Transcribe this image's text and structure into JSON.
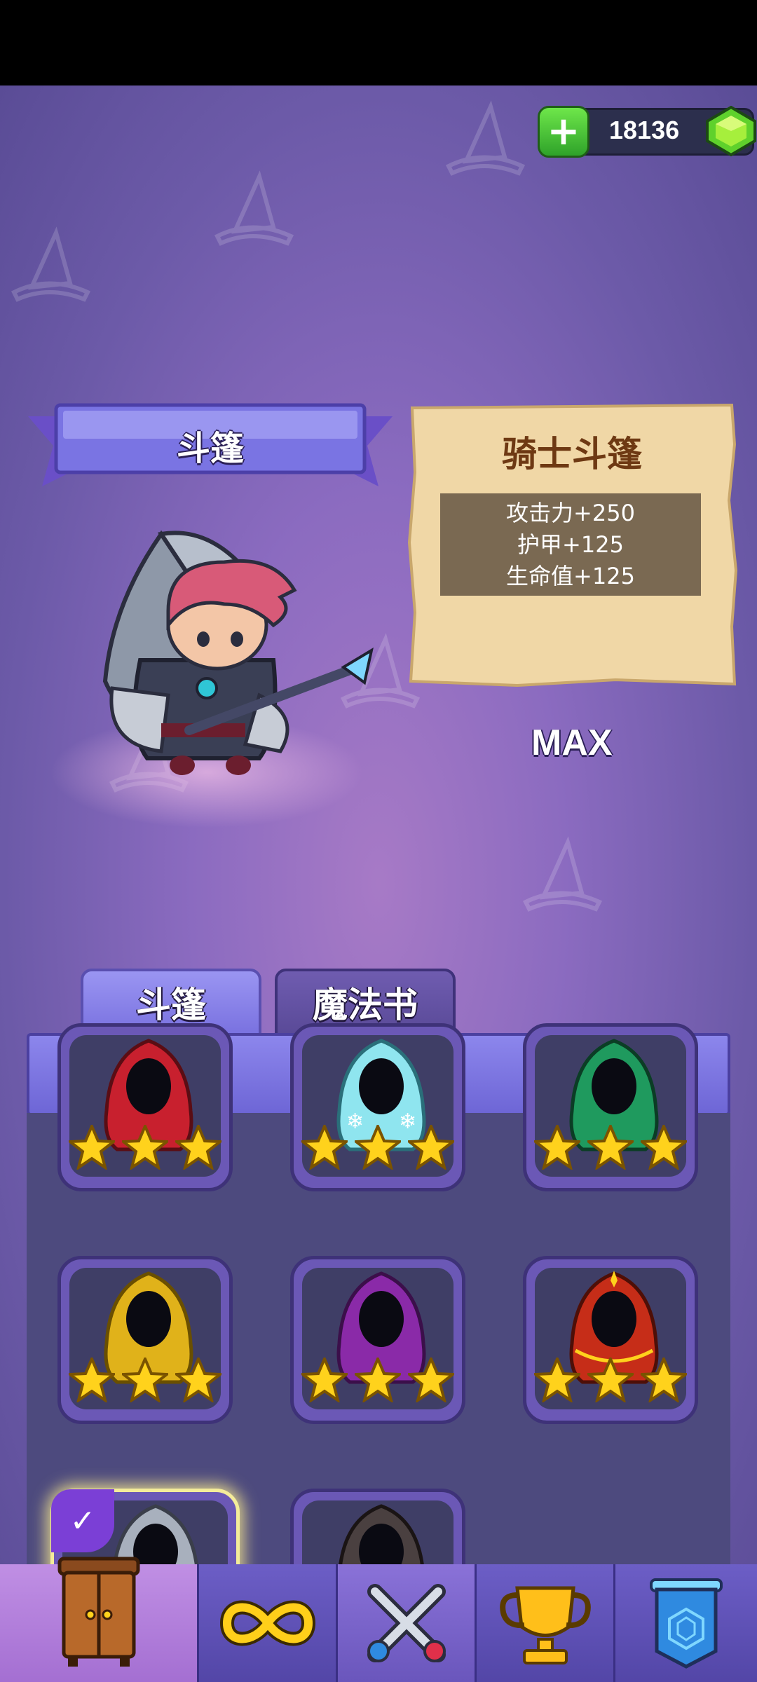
{
  "currency": {
    "amount": "18136",
    "add_label": "+"
  },
  "header": {
    "ribbon_title": "斗篷"
  },
  "item_card": {
    "name": "骑士斗篷",
    "stats": [
      "攻击力+250",
      "护甲+125",
      "生命值+125"
    ]
  },
  "level_label": "MAX",
  "tabs": {
    "cloak": "斗篷",
    "spellbook": "魔法书"
  },
  "cloaks": [
    {
      "color": "red",
      "stars": 3
    },
    {
      "color": "ice",
      "stars": 3
    },
    {
      "color": "green",
      "stars": 3
    },
    {
      "color": "yellow",
      "stars": 3
    },
    {
      "color": "purple",
      "stars": 3
    },
    {
      "color": "crimson",
      "stars": 3
    },
    {
      "color": "grey",
      "stars": 0,
      "selected": true
    },
    {
      "color": "dark",
      "stars": 0
    }
  ],
  "check_mark": "✓",
  "bottom_nav": [
    {
      "icon": "wardrobe-icon"
    },
    {
      "icon": "infinity-icon"
    },
    {
      "icon": "crossed-swords-icon"
    },
    {
      "icon": "trophy-icon"
    },
    {
      "icon": "banner-shield-icon"
    }
  ]
}
